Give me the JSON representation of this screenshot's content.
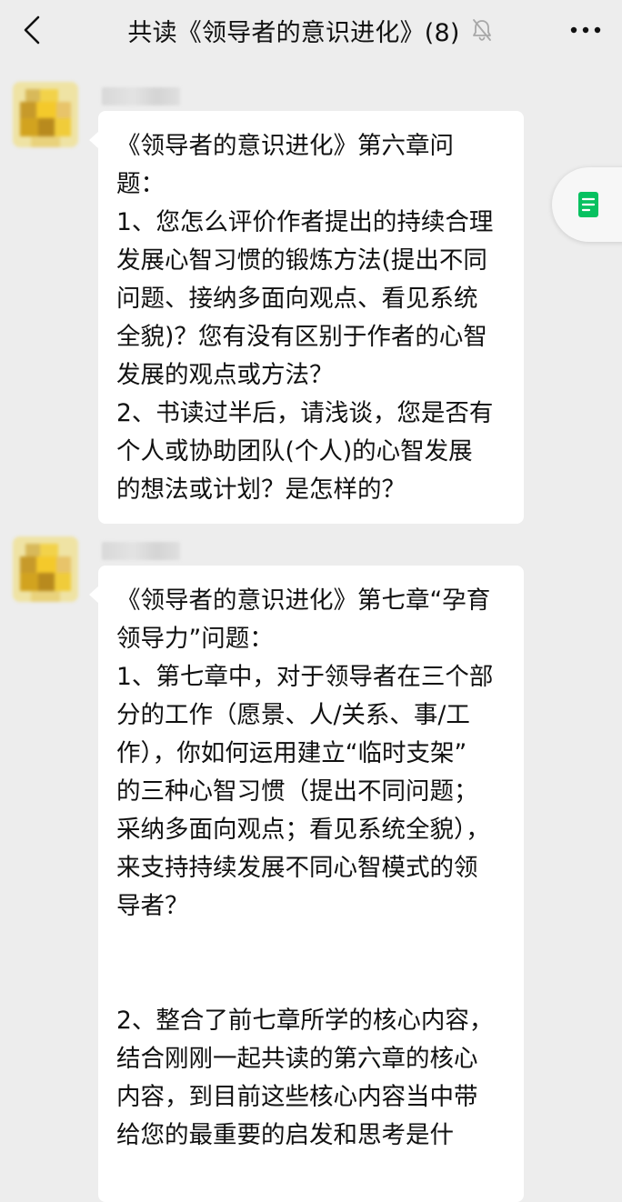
{
  "header": {
    "back_icon": "chevron-left-icon",
    "title": "共读《领导者的意识进化》(8)",
    "mute_icon": "bell-muted-icon",
    "more_icon": "ellipsis-icon"
  },
  "messages": [
    {
      "lines": [
        "《领导者的意识进化》第六章问",
        "题：",
        "1、您怎么评价作者提出的持续合理",
        "发展心智习惯的锻炼方法(提出不同",
        "问题、接纳多面向观点、看见系统",
        "全貌)？您有没有区别于作者的心智",
        "发展的观点或方法？",
        "2、书读过半后，请浅谈，您是否有",
        "个人或协助团队(个人)的心智发展",
        "的想法或计划？是怎样的？"
      ]
    },
    {
      "lines": [
        "《领导者的意识进化》第七章“孕育",
        "领导力”问题：",
        "1、第七章中，对于领导者在三个部",
        "分的工作（愿景、人/关系、事/工",
        "作），你如何运用建立“临时支架”",
        "的三种心智习惯（提出不同问题；",
        "采纳多面向观点；看见系统全貌），",
        "来支持持续发展不同心智模式的领",
        "导者？",
        "",
        "",
        "2、整合了前七章所学的核心内容，",
        "结合刚刚一起共读的第六章的核心",
        "内容，到目前这些核心内容当中带",
        "给您的最重要的启发和思考是什"
      ]
    }
  ],
  "float_button": {
    "icon": "document-icon",
    "accent_color": "#07c160"
  }
}
